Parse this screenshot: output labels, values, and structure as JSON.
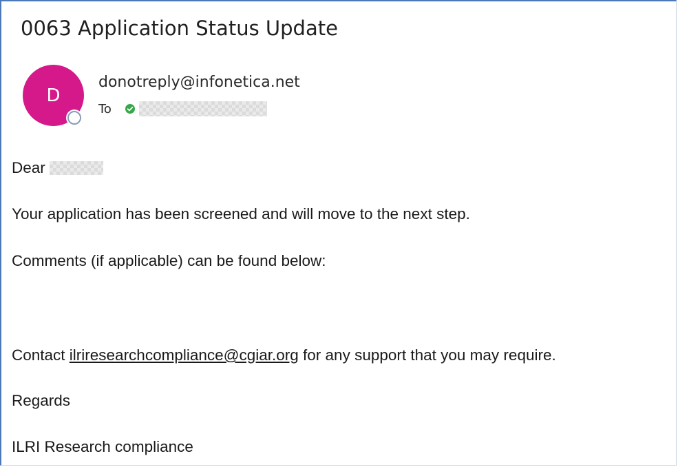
{
  "email": {
    "subject": "0063 Application Status Update",
    "avatar_initial": "D",
    "sender": "donotreply@infonetica.net",
    "to_label": "To",
    "recipient": "",
    "colors": {
      "avatar": "#d6198a",
      "presence_ring": "#8a9bb8",
      "verified_check": "#37a84a",
      "frame_border": "#4a78b8"
    },
    "icons": {
      "verified": "check-circle-icon",
      "presence": "presence-status-icon"
    }
  },
  "message": {
    "greeting": "Dear",
    "recipient_name": "",
    "line1": "Your application has been screened and will move to the next step.",
    "line2": "Comments (if applicable) can be found below:",
    "contact_prefix": "Contact ",
    "contact_email": "ilriresearchcompliance@cgiar.org",
    "contact_suffix": " for any support that you may require.",
    "closing": "Regards",
    "signature": "ILRI Research compliance"
  }
}
